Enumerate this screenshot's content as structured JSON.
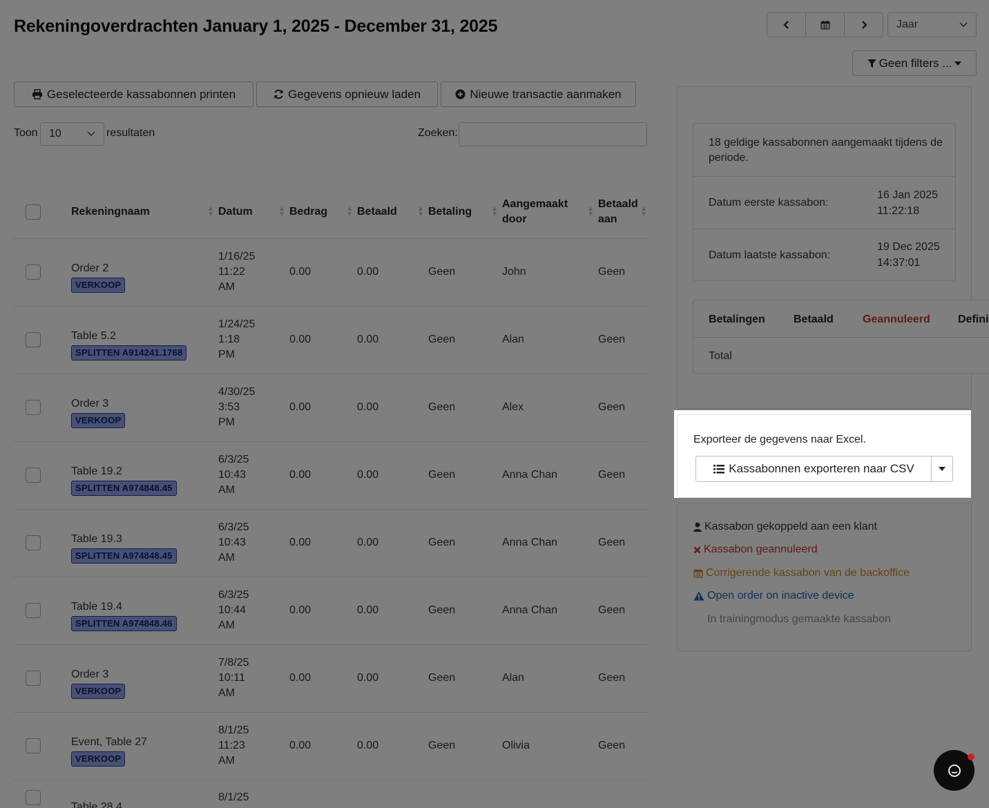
{
  "header": {
    "title": "Rekeningoverdrachten January 1, 2025 - December 31, 2025",
    "period_select": "Jaar",
    "filter_label": "Geen filters ..."
  },
  "actions": {
    "print": "Geselecteerde kassabonnen printen",
    "reload": "Gegevens opnieuw laden",
    "new": "Nieuwe transactie aanmaken"
  },
  "list_controls": {
    "show_prefix": "Toon",
    "page_size": "10",
    "show_suffix": "resultaten",
    "search_label": "Zoeken:",
    "search_value": ""
  },
  "table": {
    "columns": [
      "Rekeningnaam",
      "Datum",
      "Bedrag",
      "Betaald",
      "Betaling",
      "Aangemaakt door",
      "Betaald aan"
    ],
    "rows": [
      {
        "name": "Order 2",
        "badge": "VERKOOP",
        "date_line1": "1/16/25",
        "date_line2": "11:22",
        "date_line3": "AM",
        "amount": "0.00",
        "paid": "0.00",
        "payment": "Geen",
        "created_by": "John",
        "paid_to": "Geen"
      },
      {
        "name": "Table 5.2",
        "badge": "SPLITTEN A914241.1768",
        "date_line1": "1/24/25",
        "date_line2": "1:18",
        "date_line3": "PM",
        "amount": "0.00",
        "paid": "0.00",
        "payment": "Geen",
        "created_by": "Alan",
        "paid_to": "Geen"
      },
      {
        "name": "Order 3",
        "badge": "VERKOOP",
        "date_line1": "4/30/25",
        "date_line2": "3:53",
        "date_line3": "PM",
        "amount": "0.00",
        "paid": "0.00",
        "payment": "Geen",
        "created_by": "Alex",
        "paid_to": "Geen"
      },
      {
        "name": "Table 19.2",
        "badge": "SPLITTEN A974848.45",
        "date_line1": "6/3/25",
        "date_line2": "10:43",
        "date_line3": "AM",
        "amount": "0.00",
        "paid": "0.00",
        "payment": "Geen",
        "created_by": "Anna Chan",
        "paid_to": "Geen"
      },
      {
        "name": "Table 19.3",
        "badge": "SPLITTEN A974848.45",
        "date_line1": "6/3/25",
        "date_line2": "10:43",
        "date_line3": "AM",
        "amount": "0.00",
        "paid": "0.00",
        "payment": "Geen",
        "created_by": "Anna Chan",
        "paid_to": "Geen"
      },
      {
        "name": "Table 19.4",
        "badge": "SPLITTEN A974848.46",
        "date_line1": "6/3/25",
        "date_line2": "10:44",
        "date_line3": "AM",
        "amount": "0.00",
        "paid": "0.00",
        "payment": "Geen",
        "created_by": "Anna Chan",
        "paid_to": "Geen"
      },
      {
        "name": "Order 3",
        "badge": "VERKOOP",
        "date_line1": "7/8/25",
        "date_line2": "10:11",
        "date_line3": "AM",
        "amount": "0.00",
        "paid": "0.00",
        "payment": "Geen",
        "created_by": "Alan",
        "paid_to": "Geen"
      },
      {
        "name": "Event, Table 27",
        "badge": "VERKOOP",
        "date_line1": "8/1/25",
        "date_line2": "11:23",
        "date_line3": "AM",
        "amount": "0.00",
        "paid": "0.00",
        "payment": "Geen",
        "created_by": "Olivia",
        "paid_to": "Geen"
      },
      {
        "name": "Table 28.4",
        "badge": "",
        "date_line1": "8/1/25",
        "date_line2": "",
        "date_line3": "",
        "amount": "",
        "paid": "",
        "payment": "",
        "created_by": "",
        "paid_to": ""
      }
    ]
  },
  "summary": {
    "valid_count_text": "18 geldige kassabonnen aangemaakt tijdens de periode.",
    "first_label": "Datum eerste kassabon:",
    "first_date": "16 Jan 2025",
    "first_time": "11:22:18",
    "last_label": "Datum laatste kassabon:",
    "last_date": "19 Dec 2025",
    "last_time": "14:37:01"
  },
  "payments": {
    "headers": [
      "Betalingen",
      "Betaald",
      "Geannuleerd",
      "Defini"
    ],
    "total_label": "Total"
  },
  "export": {
    "text": "Exporteer de gegevens naar Excel.",
    "button": "Kassabonnen exporteren naar CSV"
  },
  "legend": [
    {
      "icon": "user-icon",
      "label": "Kassabon gekoppeld aan een klant",
      "color": "#333333"
    },
    {
      "icon": "cross-icon",
      "label": "Kassabon geannuleerd",
      "color": "#c0392b"
    },
    {
      "icon": "calendar-icon",
      "label": "Corrigerende kassabon van de backoffice",
      "color": "#c9852a"
    },
    {
      "icon": "warning-icon",
      "label": "Open order on inactive device",
      "color": "#1f5fa8"
    },
    {
      "icon": "",
      "label": "In trainingmodus gemaakte kassabon",
      "color": "#888888"
    }
  ],
  "colors": {
    "cancelled": "#c0392b",
    "badge_bg": "#8fa0ea",
    "badge_border": "#2d3a8c"
  }
}
